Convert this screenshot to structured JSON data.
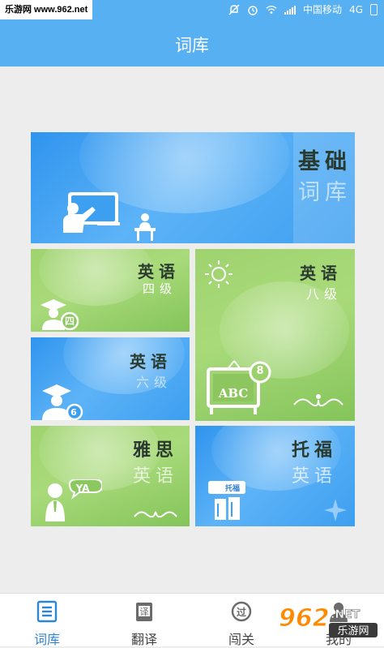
{
  "watermark": "乐游网 www.962.net",
  "statusbar": {
    "carrier": "中国移动",
    "network": "4G"
  },
  "header": {
    "title": "词库"
  },
  "tiles": [
    {
      "id": "basic",
      "title": "基础",
      "subtitle": "词库"
    },
    {
      "id": "cet4",
      "title": "英语",
      "subtitle": "四级",
      "badge": "四"
    },
    {
      "id": "tem8",
      "title": "英语",
      "subtitle": "八级",
      "board_text": "ABC",
      "badge": "8"
    },
    {
      "id": "cet6",
      "title": "英语",
      "subtitle": "六级",
      "badge": "6"
    },
    {
      "id": "ielts",
      "title": "雅思",
      "subtitle": "英语",
      "bubble": "YA"
    },
    {
      "id": "toefl",
      "title": "托福",
      "subtitle": "英语",
      "tag": "托福"
    }
  ],
  "nav": [
    {
      "label": "词库",
      "icon": "book-list-icon",
      "active": true
    },
    {
      "label": "翻译",
      "icon": "translate-icon",
      "active": false
    },
    {
      "label": "闯关",
      "icon": "pass-level-icon",
      "active": false
    },
    {
      "label": "我的",
      "icon": "profile-icon",
      "active": false
    }
  ],
  "logo_watermark": {
    "main": "962",
    "domain": ".NET",
    "name": "乐游网"
  },
  "colors": {
    "header": "#57b0f1",
    "active_nav": "#2c86d6",
    "blue_tile": "#3d9ff0",
    "green_tile": "#a9da7a"
  }
}
